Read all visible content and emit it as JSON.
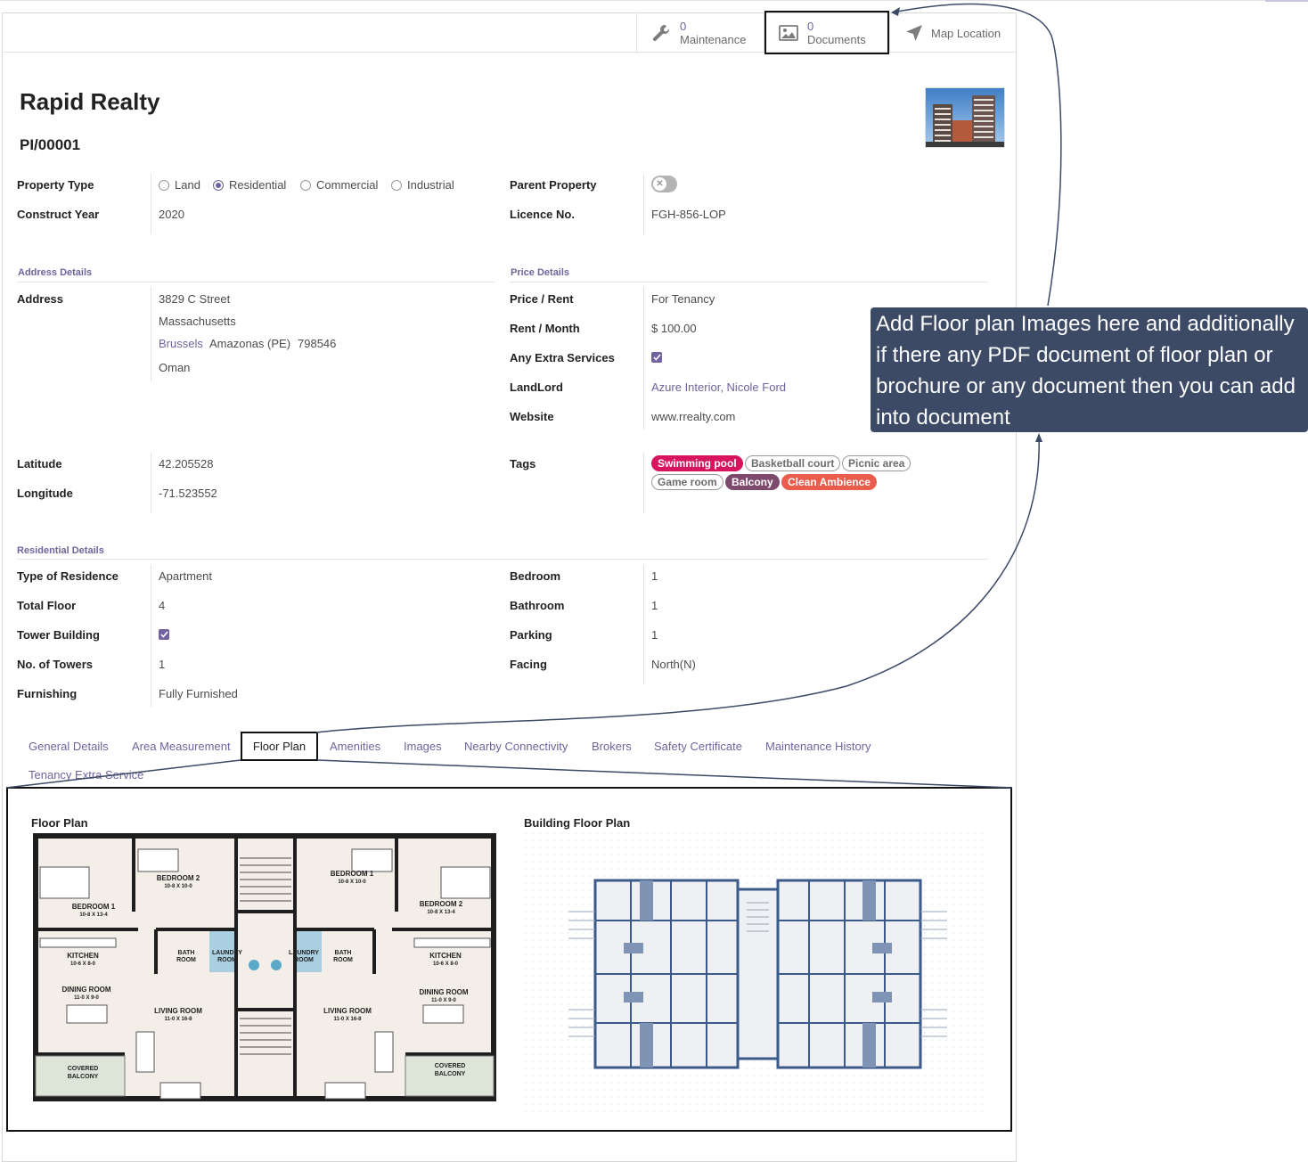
{
  "buttons": {
    "maintenance": {
      "count": "0",
      "label": "Maintenance"
    },
    "documents": {
      "count": "0",
      "label": "Documents"
    },
    "map": {
      "label": "Map Location"
    }
  },
  "record": {
    "title": "Rapid Realty",
    "reference": "PI/00001"
  },
  "property_type": {
    "label": "Property Type",
    "options": [
      "Land",
      "Residential",
      "Commercial",
      "Industrial"
    ],
    "selected": "Residential"
  },
  "construct_year": {
    "label": "Construct Year",
    "value": "2020"
  },
  "parent_property": {
    "label": "Parent Property",
    "enabled": false
  },
  "licence": {
    "label": "Licence No.",
    "value": "FGH-856-LOP"
  },
  "address": {
    "section": "Address Details",
    "label": "Address",
    "street": "3829 C Street",
    "street2": "Massachusetts",
    "city": "Brussels",
    "state": "Amazonas (PE)",
    "zip": "798546",
    "country": "Oman"
  },
  "price": {
    "section": "Price Details",
    "price_rent": {
      "label": "Price / Rent",
      "value": "For Tenancy"
    },
    "rent_month": {
      "label": "Rent / Month",
      "value": "$ 100.00"
    },
    "extra_services": {
      "label": "Any Extra Services",
      "checked": true
    },
    "landlord": {
      "label": "LandLord",
      "value": "Azure Interior, Nicole Ford"
    },
    "website": {
      "label": "Website",
      "value": "www.rrealty.com"
    }
  },
  "geo": {
    "latitude": {
      "label": "Latitude",
      "value": "42.205528"
    },
    "longitude": {
      "label": "Longitude",
      "value": "-71.523552"
    }
  },
  "tags": {
    "label": "Tags",
    "items": [
      {
        "name": "Swimming pool",
        "style": "filled",
        "color": "#d6145f"
      },
      {
        "name": "Basketball court",
        "style": "outline",
        "color": "#6c6c6c"
      },
      {
        "name": "Picnic area",
        "style": "outline",
        "color": "#6c6c6c"
      },
      {
        "name": "Game room",
        "style": "outline",
        "color": "#6c6c6c"
      },
      {
        "name": "Balcony",
        "style": "filled",
        "color": "#7d4a6e"
      },
      {
        "name": "Clean Ambience",
        "style": "filled",
        "color": "#ea5d4c"
      }
    ]
  },
  "residential": {
    "section": "Residential Details",
    "type_of_residence": {
      "label": "Type of Residence",
      "value": "Apartment"
    },
    "total_floor": {
      "label": "Total Floor",
      "value": "4"
    },
    "tower_building": {
      "label": "Tower Building",
      "checked": true
    },
    "no_of_towers": {
      "label": "No. of Towers",
      "value": "1"
    },
    "furnishing": {
      "label": "Furnishing",
      "value": "Fully Furnished"
    },
    "bedroom": {
      "label": "Bedroom",
      "value": "1"
    },
    "bathroom": {
      "label": "Bathroom",
      "value": "1"
    },
    "parking": {
      "label": "Parking",
      "value": "1"
    },
    "facing": {
      "label": "Facing",
      "value": "North(N)"
    }
  },
  "tabs": [
    "General Details",
    "Area Measurement",
    "Floor Plan",
    "Amenities",
    "Images",
    "Nearby Connectivity",
    "Brokers",
    "Safety Certificate",
    "Maintenance History",
    "Tenancy Extra Service"
  ],
  "active_tab": "Floor Plan",
  "floor_plan": {
    "floor_plan_label": "Floor Plan",
    "building_floor_plan_label": "Building Floor Plan",
    "rooms": {
      "bedroom1": "BEDROOM 1",
      "bedroom1_size": "10-8 X 13-4",
      "bedroom2": "BEDROOM 2",
      "bedroom2_size": "10-8 X 10-0",
      "bedroom1r": "BEDROOM 1",
      "bedroom1r_size": "10-8 X 10-0",
      "bedroom2r": "BEDROOM 2",
      "bedroom2r_size": "10-8 X 13-4",
      "kitchen": "KITCHEN",
      "kitchen_size": "10-6 X 8-0",
      "dining": "DINING ROOM",
      "dining_size": "11-0 X 9-0",
      "living": "LIVING ROOM",
      "living_size": "11-0 X 16-8",
      "bath": "BATH",
      "bath2": "ROOM",
      "laundry": "LAUNDRY",
      "laundry2": "ROOM",
      "balcony": "COVERED",
      "balcony2": "BALCONY"
    }
  },
  "callout": {
    "text": "Add Floor plan Images here and additionally if there any PDF document of floor plan or brochure or any document then you can add into document"
  }
}
